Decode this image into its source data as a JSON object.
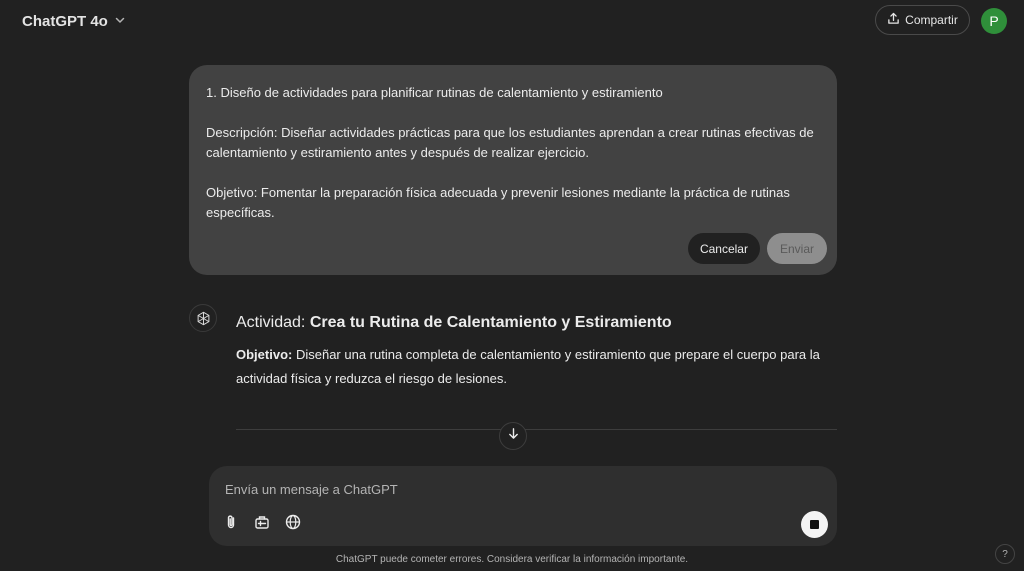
{
  "header": {
    "model_name": "ChatGPT 4o",
    "share_label": "Compartir",
    "avatar_initial": "P",
    "avatar_color": "#2f8f3a"
  },
  "edit_message": {
    "title_line": "1. Diseño de actividades para planificar rutinas de calentamiento y estiramiento",
    "description": "Descripción: Diseñar actividades prácticas para que los estudiantes aprendan a crear rutinas efectivas de calentamiento y estiramiento antes y después de realizar ejercicio.",
    "objective": "Objetivo: Fomentar la preparación física adecuada y prevenir lesiones mediante la práctica de rutinas específicas.",
    "cancel_label": "Cancelar",
    "send_label": "Enviar"
  },
  "assistant": {
    "title_prefix": "Actividad: ",
    "title_bold": "Crea tu Rutina de Calentamiento y Estiramiento",
    "objective_label": "Objetivo:",
    "objective_text": " Diseñar una rutina completa de calentamiento y estiramiento que prepare el cuerpo para la actividad física y reduzca el riesgo de lesiones."
  },
  "composer": {
    "placeholder": "Envía un mensaje a ChatGPT",
    "tools": [
      "paperclip-icon",
      "toolbox-icon",
      "globe-icon"
    ],
    "stop_icon": "stop-icon"
  },
  "footer": {
    "disclaimer": "ChatGPT puede cometer errores. Considera verificar la información importante.",
    "help_label": "?"
  },
  "colors": {
    "background": "#212121",
    "bubble": "#424242",
    "composer": "#2f2f2f"
  }
}
